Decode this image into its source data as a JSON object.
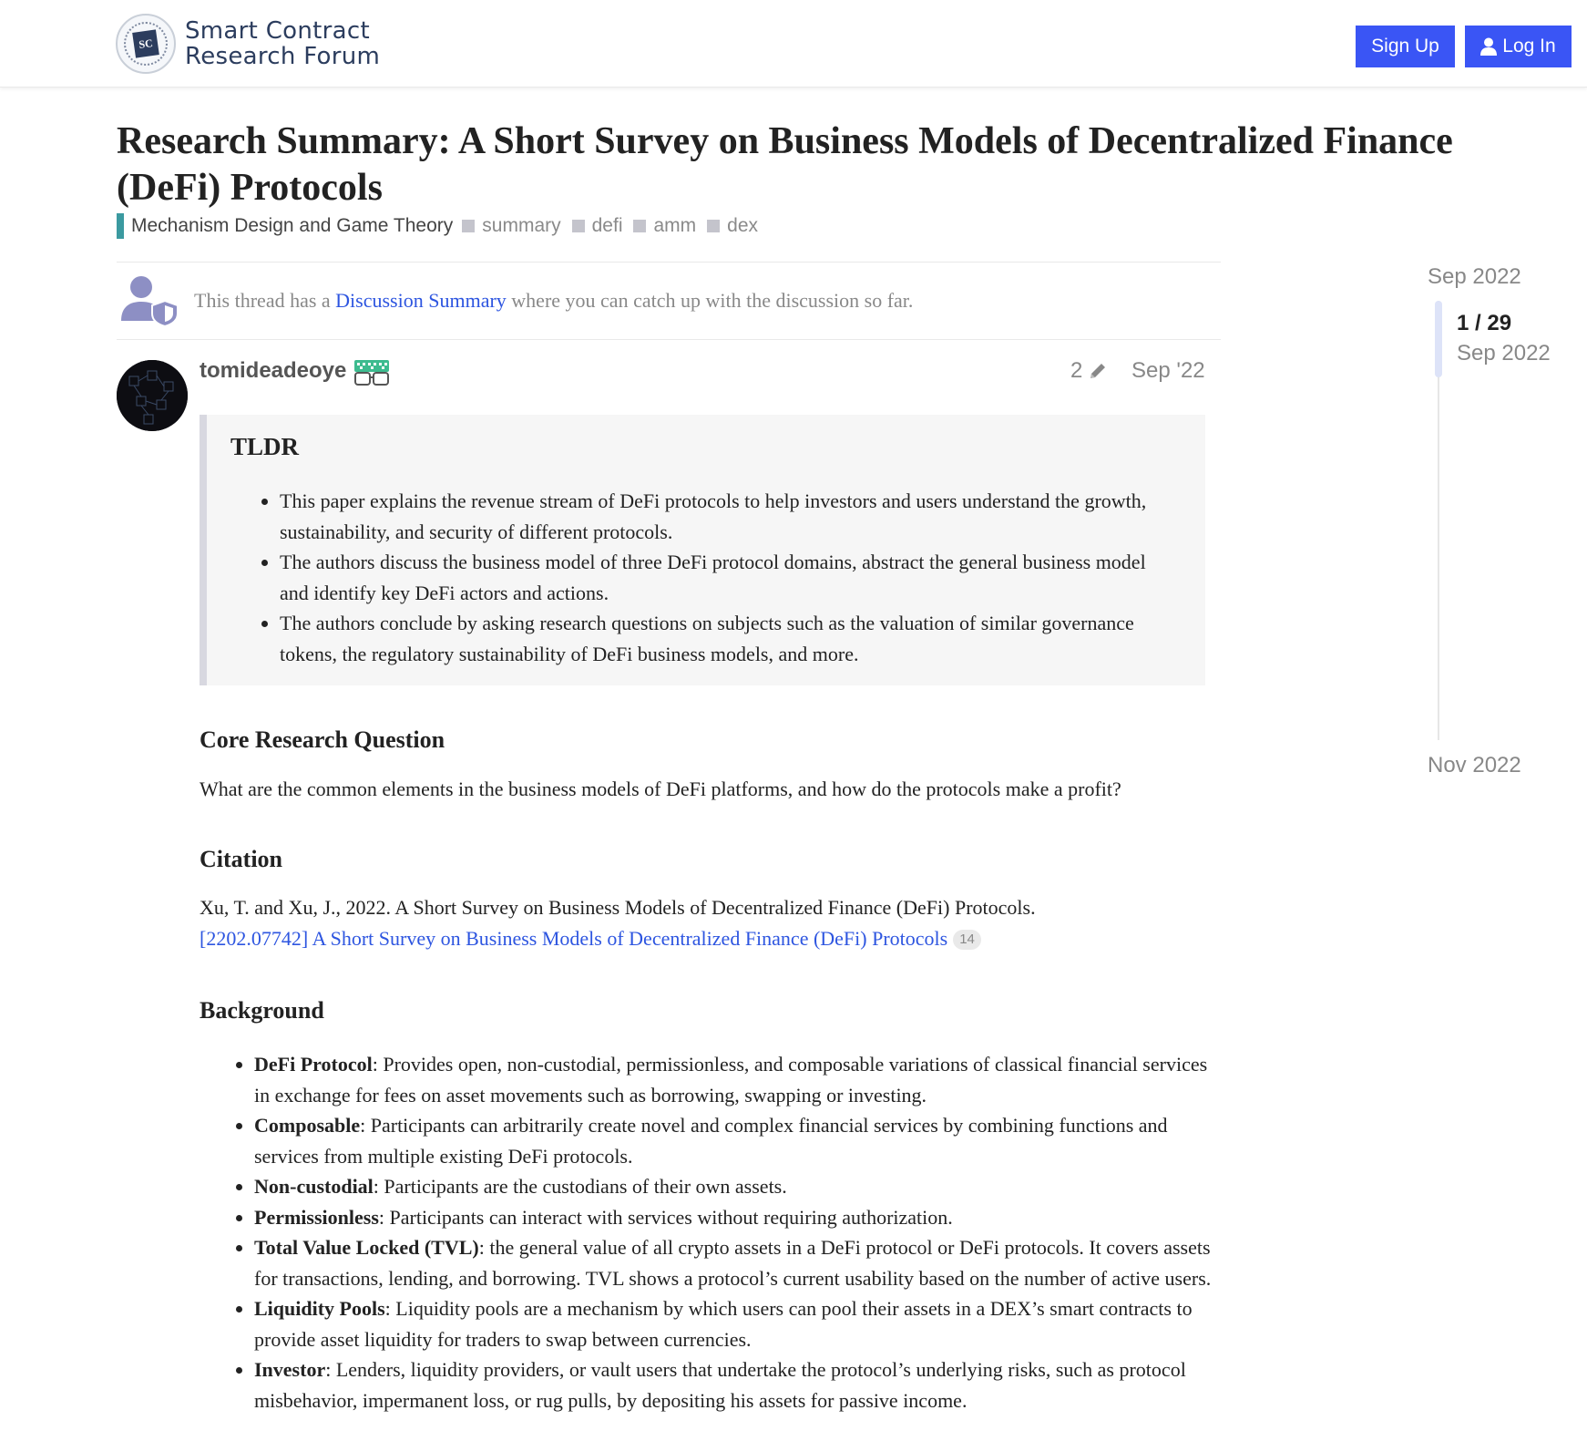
{
  "header": {
    "logo_line1": "Smart Contract",
    "logo_line2": "Research Forum",
    "logo_mono": "SC",
    "signup_label": "Sign Up",
    "login_label": "Log In"
  },
  "topic": {
    "title": "Research Summary: A Short Survey on Business Models of Decentralized Finance (DeFi) Protocols",
    "category": "Mechanism Design and Game Theory",
    "category_color": "#3b9aa0",
    "tags": [
      "summary",
      "defi",
      "amm",
      "dex"
    ]
  },
  "notice": {
    "prefix": "This thread has a ",
    "link": "Discussion Summary",
    "suffix": " where you can catch up with the discussion so far."
  },
  "post": {
    "username": "tomideadeoye",
    "edit_count": "2",
    "date": "Sep '22",
    "tldr_heading": "TLDR",
    "tldr_items": [
      "This paper explains the revenue stream of DeFi protocols to help investors and users understand the growth, sustainability, and security of different protocols.",
      "The authors discuss the business model of three DeFi protocol domains, abstract the general business model and identify key DeFi actors and actions.",
      "The authors conclude by asking research questions on subjects such as the valuation of similar governance tokens, the regulatory sustainability of DeFi business models, and more."
    ],
    "core_heading": "Core Research Question",
    "core_text": "What are the common elements in the business models of DeFi platforms, and how do the protocols make a profit?",
    "citation_heading": "Citation",
    "citation_text": "Xu, T. and Xu, J., 2022. A Short Survey on Business Models of Decentralized Finance (DeFi) Protocols.",
    "citation_link": "[2202.07742] A Short Survey on Business Models of Decentralized Finance (DeFi) Protocols",
    "citation_clicks": "14",
    "background_heading": "Background",
    "background_items": [
      {
        "term": "DeFi Protocol",
        "text": ": Provides open, non-custodial, permissionless, and composable variations of classical financial services in exchange for fees on asset movements such as borrowing, swapping or investing."
      },
      {
        "term": "Composable",
        "text": ": Participants can arbitrarily create novel and complex financial services by combining functions and services from multiple existing DeFi protocols."
      },
      {
        "term": "Non-custodial",
        "text": ": Participants are the custodians of their own assets."
      },
      {
        "term": "Permissionless",
        "text": ": Participants can interact with services without requiring authorization."
      },
      {
        "term": "Total Value Locked (TVL)",
        "text": ": the general value of all crypto assets in a DeFi protocol or DeFi protocols. It covers assets for transactions, lending, and borrowing. TVL shows a protocol’s current usability based on the number of active users."
      },
      {
        "term": "Liquidity Pools",
        "text": ": Liquidity pools are a mechanism by which users can pool their assets in a DEX’s smart contracts to provide asset liquidity for traders to swap between currencies."
      },
      {
        "term": "Investor",
        "text": ": Lenders, liquidity providers, or vault users that undertake the protocol’s underlying risks, such as protocol misbehavior, impermanent loss, or rug pulls, by depositing his assets for passive income."
      }
    ]
  },
  "timeline": {
    "start": "Sep 2022",
    "position": "1 / 29",
    "position_date": "Sep 2022",
    "end": "Nov 2022"
  }
}
